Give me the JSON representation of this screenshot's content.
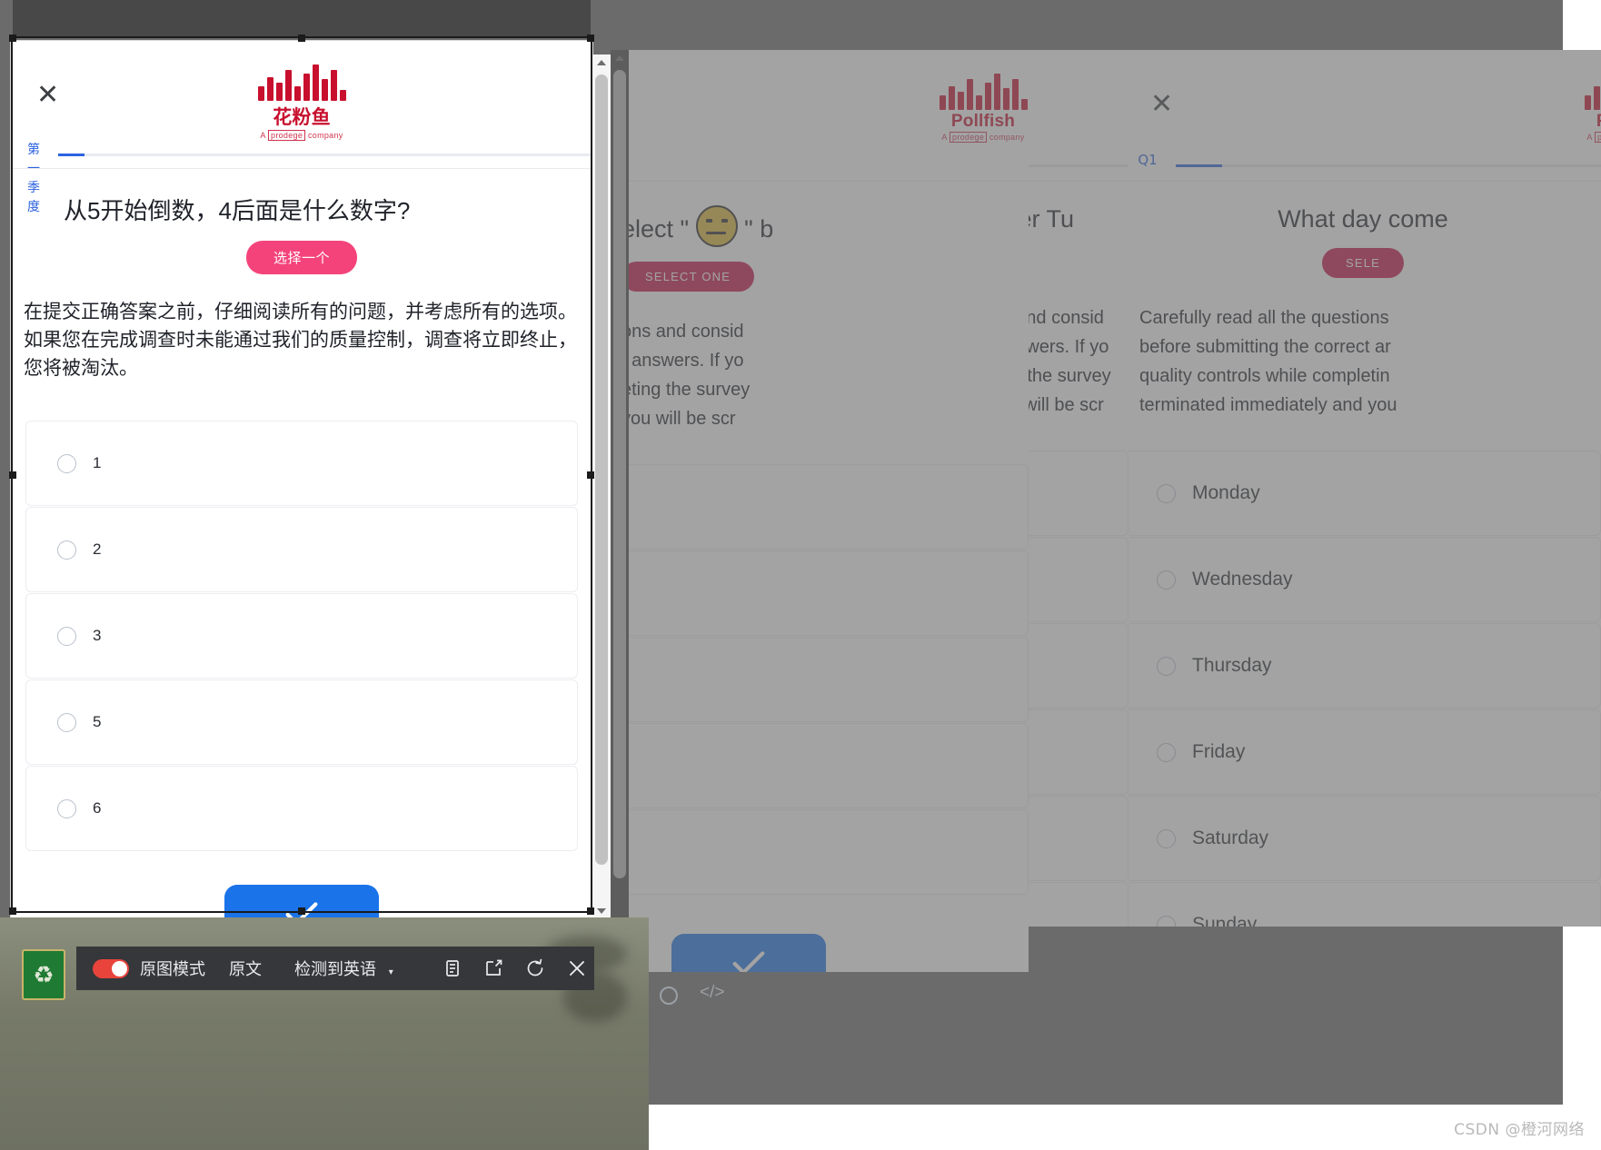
{
  "app": {
    "watermark": "CSDN @橙河网络"
  },
  "translate_bar": {
    "toggle_state": "on",
    "toggle_color": "#e8443c",
    "original_image_mode_label": "原图模式",
    "original_text_label": "原文",
    "detected_language_label": "检测到英语",
    "caret": "▾",
    "icons": [
      {
        "name": "copy-icon",
        "glyph": "copy"
      },
      {
        "name": "edit-icon",
        "glyph": "edit"
      },
      {
        "name": "retranslate-icon",
        "glyph": "refresh"
      },
      {
        "name": "close-icon",
        "glyph": "close"
      }
    ]
  },
  "front_panel": {
    "close_label": "✕",
    "logo": {
      "name": "花粉鱼",
      "sub_prefix": "A",
      "sub_boxed": "prodege",
      "sub_suffix": "company",
      "color": "#c8102e",
      "bars": [
        16,
        26,
        20,
        34,
        16,
        30,
        40,
        24,
        34,
        12
      ]
    },
    "progress": {
      "label": "第一季度",
      "percent": 5,
      "accent": "#2b62e0"
    },
    "question": "从5开始倒数，4后面是什么数字?",
    "select_one_label": "选择一个",
    "instructions": "在提交正确答案之前，仔细阅读所有的问题，并考虑所有的选项。如果您在完成调查时未能通过我们的质量控制，调查将立即终止，您将被淘汰。",
    "options": [
      "1",
      "2",
      "3",
      "5",
      "6"
    ],
    "submit_icon": "check",
    "submit_color": "#1a73e8"
  },
  "panel_2": {
    "close_label": "✕",
    "logo": {
      "name": "Pollfish",
      "sub_prefix": "A",
      "sub_boxed": "prodege",
      "sub_suffix": "company",
      "color": "#c8102e",
      "bars": [
        16,
        26,
        20,
        34,
        16,
        30,
        40,
        24,
        34,
        12
      ]
    },
    "question_fragment": "elect \" 😑 \" b",
    "select_one_label": "SELECT ONE",
    "instructions_fragment_lines": [
      "ons and consid",
      "t answers. If yo",
      "eting the survey",
      "you will be scr"
    ],
    "submit_icon": "check",
    "submit_color": "#1a73e8"
  },
  "panel_3": {
    "close_label": "✕",
    "logo": {
      "name": "Pollfish",
      "sub_prefix": "A",
      "sub_boxed": "prodege",
      "sub_suffix": "company",
      "color": "#c8102e",
      "bars": [
        16,
        26,
        20,
        34,
        16,
        30,
        40,
        24,
        34,
        12
      ]
    },
    "progress": {
      "label": "Q1",
      "percent": 11,
      "accent": "#2b62e0"
    },
    "question": "What day comes after Tu",
    "select_one_label": "SELECT ONE",
    "instructions_lines": [
      "Carefully read all the questions and consid",
      "before submitting the correct answers. If yo",
      "quality controls while completing the survey",
      "terminated immediately and you will be scr"
    ],
    "options": [
      "Monday",
      "Wednesday",
      "Thursday",
      "Friday",
      "Saturday",
      "Sunday"
    ]
  },
  "panel_4": {
    "close_label": "✕",
    "logo": {
      "name": "Pollfish",
      "sub_prefix": "A",
      "sub_boxed": "prodege",
      "sub_suffix": "company",
      "color": "#c8102e",
      "bars": [
        16,
        26,
        20,
        34,
        16,
        30,
        40,
        24,
        34,
        12
      ]
    },
    "progress": {
      "label": "Q1",
      "percent": 11,
      "accent": "#2b62e0"
    },
    "question": "What day come",
    "select_one_label": "SELE",
    "instructions_lines": [
      "Carefully read all the questions",
      "before submitting the correct ar",
      "quality controls while completin",
      "terminated immediately and you"
    ],
    "options": [
      "Monday",
      "Wednesday",
      "Thursday",
      "Friday",
      "Saturday",
      "Sunday"
    ]
  }
}
